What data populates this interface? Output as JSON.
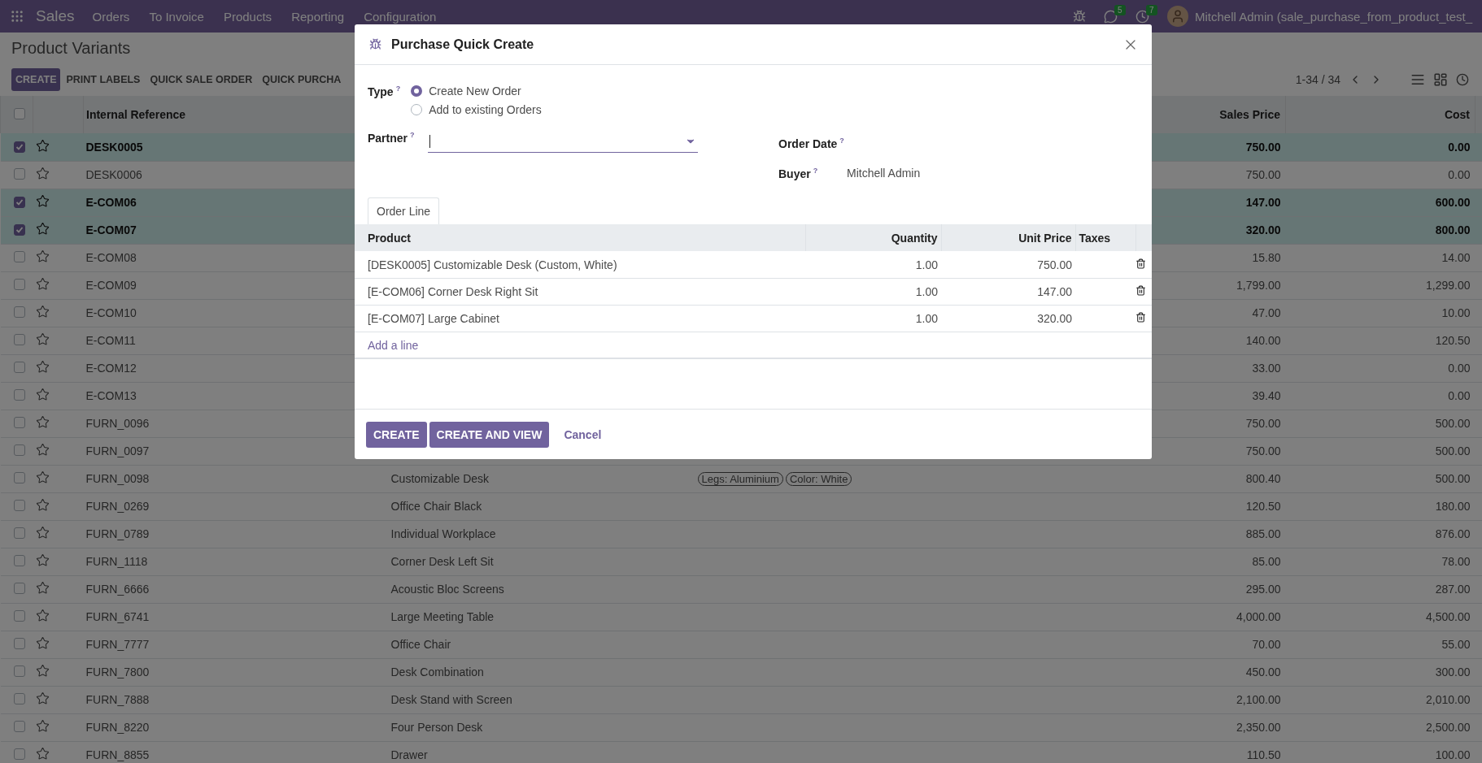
{
  "navbar": {
    "app": "Sales",
    "menu": [
      "Orders",
      "To Invoice",
      "Products",
      "Reporting",
      "Configuration"
    ],
    "messages_badge": "5",
    "activities_badge": "7",
    "user": "Mitchell Admin (sale_purchase_from_product_test_"
  },
  "breadcrumb": "Product Variants",
  "actions": [
    {
      "label": "CREATE",
      "kind": "primary"
    },
    {
      "label": "PRINT LABELS",
      "kind": "secondary"
    },
    {
      "label": "QUICK SALE ORDER",
      "kind": "secondary"
    },
    {
      "label": "QUICK PURCHA",
      "kind": "secondary"
    }
  ],
  "pager": "1-34 / 34",
  "table": {
    "select_all_checked": false,
    "columns": [
      "Internal Reference",
      "Sales Price",
      "Cost"
    ],
    "rows": [
      {
        "selected": true,
        "reference": "DESK0005",
        "sales_price": "750.00",
        "cost": "0.00"
      },
      {
        "selected": false,
        "reference": "DESK0006",
        "sales_price": "750.00",
        "cost": "0.00"
      },
      {
        "selected": true,
        "reference": "E-COM06",
        "sales_price": "147.00",
        "cost": "600.00"
      },
      {
        "selected": true,
        "reference": "E-COM07",
        "sales_price": "320.00",
        "cost": "800.00"
      },
      {
        "selected": false,
        "reference": "E-COM08",
        "sales_price": "15.80",
        "cost": "14.00"
      },
      {
        "selected": false,
        "reference": "E-COM09",
        "sales_price": "1,799.00",
        "cost": "1,299.00"
      },
      {
        "selected": false,
        "reference": "E-COM10",
        "sales_price": "47.00",
        "cost": "10.00"
      },
      {
        "selected": false,
        "reference": "E-COM11",
        "sales_price": "140.00",
        "cost": "120.50"
      },
      {
        "selected": false,
        "reference": "E-COM12",
        "sales_price": "33.00",
        "cost": "0.00"
      },
      {
        "selected": false,
        "reference": "E-COM13",
        "sales_price": "39.40",
        "cost": "0.00"
      },
      {
        "selected": false,
        "reference": "FURN_0096",
        "sales_price": "750.00",
        "cost": "500.00"
      },
      {
        "selected": false,
        "reference": "FURN_0097",
        "sales_price": "750.00",
        "cost": "500.00"
      },
      {
        "selected": false,
        "reference": "FURN_0098",
        "name": "Customizable Desk",
        "variant_values": [
          "Legs: Aluminium",
          "Color: White"
        ],
        "sales_price": "800.40",
        "cost": "500.00"
      },
      {
        "selected": false,
        "reference": "FURN_0269",
        "name": "Office Chair Black",
        "sales_price": "120.50",
        "cost": "180.00"
      },
      {
        "selected": false,
        "reference": "FURN_0789",
        "name": "Individual Workplace",
        "sales_price": "885.00",
        "cost": "876.00"
      },
      {
        "selected": false,
        "reference": "FURN_1118",
        "name": "Corner Desk Left Sit",
        "sales_price": "85.00",
        "cost": "78.00"
      },
      {
        "selected": false,
        "reference": "FURN_6666",
        "name": "Acoustic Bloc Screens",
        "sales_price": "295.00",
        "cost": "287.00"
      },
      {
        "selected": false,
        "reference": "FURN_6741",
        "name": "Large Meeting Table",
        "sales_price": "4,000.00",
        "cost": "4,500.00"
      },
      {
        "selected": false,
        "reference": "FURN_7777",
        "name": "Office Chair",
        "sales_price": "70.00",
        "cost": "55.00"
      },
      {
        "selected": false,
        "reference": "FURN_7800",
        "name": "Desk Combination",
        "sales_price": "450.00",
        "cost": "300.00"
      },
      {
        "selected": false,
        "reference": "FURN_7888",
        "name": "Desk Stand with Screen",
        "sales_price": "2,100.00",
        "cost": "2,010.00"
      },
      {
        "selected": false,
        "reference": "FURN_8220",
        "name": "Four Person Desk",
        "sales_price": "2,350.00",
        "cost": "2,500.00"
      },
      {
        "selected": false,
        "reference": "FURN_8855",
        "name": "Drawer",
        "sales_price": "110.50",
        "cost": "100.00"
      }
    ]
  },
  "dialog": {
    "title": "Purchase Quick Create",
    "type": {
      "label": "Type",
      "help": "?",
      "options": [
        {
          "label": "Create New Order",
          "selected": true
        },
        {
          "label": "Add to existing Orders",
          "selected": false
        }
      ]
    },
    "partner": {
      "label": "Partner",
      "help": "?"
    },
    "order_date": {
      "label": "Order Date",
      "help": "?"
    },
    "buyer": {
      "label": "Buyer",
      "help": "?",
      "value": "Mitchell Admin"
    },
    "tab": "Order Line",
    "lines": {
      "columns": [
        "Product",
        "Quantity",
        "Unit Price",
        "Taxes"
      ],
      "rows": [
        {
          "product": "[DESK0005] Customizable Desk (Custom, White)",
          "quantity": "1.00",
          "unit_price": "750.00"
        },
        {
          "product": "[E-COM06] Corner Desk Right Sit",
          "quantity": "1.00",
          "unit_price": "147.00"
        },
        {
          "product": "[E-COM07] Large Cabinet",
          "quantity": "1.00",
          "unit_price": "320.00"
        }
      ],
      "add_line": "Add a line"
    },
    "buttons": [
      {
        "label": "CREATE",
        "kind": "primary"
      },
      {
        "label": "CREATE AND VIEW",
        "kind": "primary"
      },
      {
        "label": "Cancel",
        "kind": "link"
      }
    ]
  }
}
